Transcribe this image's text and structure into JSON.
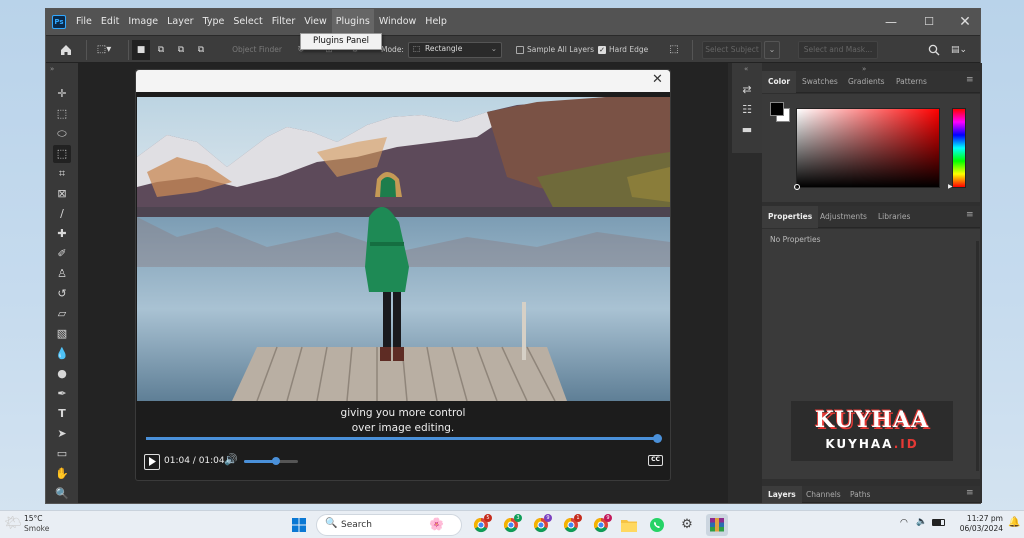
{
  "app": {
    "logo": "Ps",
    "menus": [
      "File",
      "Edit",
      "Image",
      "Layer",
      "Type",
      "Select",
      "Filter",
      "View",
      "Plugins",
      "Window",
      "Help"
    ],
    "active_menu": "Plugins",
    "dropdown_item": "Plugins Panel"
  },
  "options_bar": {
    "object_finder": "Object Finder",
    "mode_label": "Mode:",
    "mode_value": "Rectangle",
    "sample_all_layers": "Sample All Layers",
    "hard_edge": "Hard Edge",
    "select_subject": "Select Subject",
    "select_and_mask": "Select and Mask..."
  },
  "color_panel": {
    "tabs": [
      "Color",
      "Swatches",
      "Gradients",
      "Patterns"
    ],
    "active": "Color"
  },
  "properties_panel": {
    "tabs": [
      "Properties",
      "Adjustments",
      "Libraries"
    ],
    "active": "Properties",
    "empty_text": "No Properties"
  },
  "layers_panel": {
    "tabs": [
      "Layers",
      "Channels",
      "Paths"
    ],
    "active": "Layers"
  },
  "watermark": {
    "title": "KUYHAA",
    "subtitle_prefix": "KUYHAA",
    "subtitle_suffix": ".ID"
  },
  "video": {
    "caption_line1": "giving you more control",
    "caption_line2": "over image editing.",
    "time": "01:04 / 01:04",
    "progress": 1.0,
    "volume": 0.6,
    "cc_label": "CC"
  },
  "taskbar": {
    "weather_temp": "15°C",
    "weather_desc": "Smoke",
    "search_placeholder": "Search",
    "time": "11:27 pm",
    "date": "06/03/2024",
    "badges": [
      "5",
      "3",
      "9",
      "1",
      "9"
    ]
  },
  "colors": {
    "accent": "#4a90d9",
    "ps_blue": "#31a8ff",
    "coat_green": "#1e8a55",
    "watermark_red": "#e53935"
  }
}
